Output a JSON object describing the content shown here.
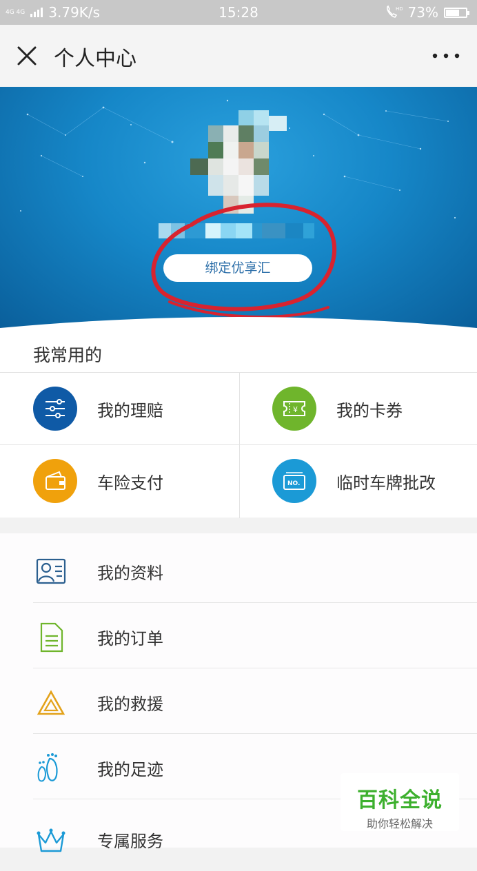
{
  "status_bar": {
    "network": "4G 4G",
    "speed": "3.79K/s",
    "time": "15:28",
    "call_icon": "hd-call-icon",
    "battery_percent": "73%",
    "battery_level": 0.73
  },
  "titlebar": {
    "title": "个人中心",
    "close_icon": "close-icon",
    "more_icon": "more-dots-icon"
  },
  "header": {
    "bind_button": "绑定优享汇"
  },
  "common": {
    "label": "我常用的",
    "items": [
      {
        "label": "我的理赔",
        "icon": "sliders-icon",
        "color": "#0f5aa6"
      },
      {
        "label": "我的卡券",
        "icon": "ticket-icon",
        "color": "#6fb52c"
      },
      {
        "label": "车险支付",
        "icon": "wallet-icon",
        "color": "#f0a10c"
      },
      {
        "label": "临时车牌批改",
        "icon": "license-plate-icon",
        "color": "#1b9ad6"
      }
    ]
  },
  "list": {
    "items": [
      {
        "label": "我的资料",
        "icon": "profile-card-icon"
      },
      {
        "label": "我的订单",
        "icon": "document-icon"
      },
      {
        "label": "我的救援",
        "icon": "warning-triangle-icon"
      },
      {
        "label": "我的足迹",
        "icon": "footprints-icon"
      },
      {
        "label": "专属服务",
        "icon": "crown-icon"
      }
    ]
  },
  "watermark": {
    "title": "百科全说",
    "subtitle": "助你轻松解决"
  },
  "colors": {
    "header_blue": "#1687c8",
    "annotation_red": "#d8232f"
  }
}
